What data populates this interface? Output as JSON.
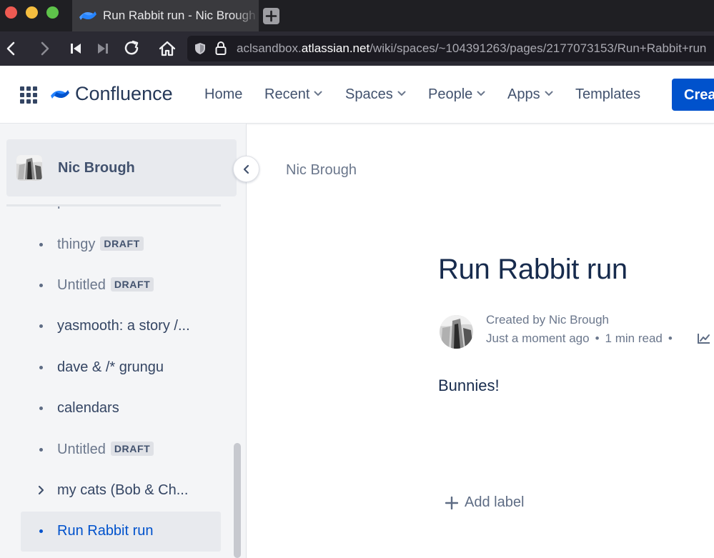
{
  "browser": {
    "tab_title": "Run Rabbit run - Nic Brough",
    "url_prefix": "aclsandbox.",
    "url_host": "atlassian.net",
    "url_path": "/wiki/spaces/~104391263/pages/2177073153/Run+Rabbit+run"
  },
  "header": {
    "logo_text": "Confluence",
    "nav": {
      "home": "Home",
      "recent": "Recent",
      "spaces": "Spaces",
      "people": "People",
      "apps": "Apps",
      "templates": "Templates"
    },
    "create_label": "Create",
    "brand_color": "#0052cc"
  },
  "sidebar": {
    "space_name": "Nic Brough",
    "draft_label": "DRAFT",
    "items": [
      {
        "label": "thingy",
        "draft": true
      },
      {
        "label": "Untitled",
        "draft": true
      },
      {
        "label": "yasmooth: a story /...",
        "draft": false
      },
      {
        "label": "dave & /* grungu",
        "draft": false
      },
      {
        "label": "calendars",
        "draft": false
      },
      {
        "label": "Untitled",
        "draft": true
      },
      {
        "label": "my cats (Bob & Ch...",
        "draft": false,
        "expandable": true
      },
      {
        "label": "Run Rabbit run",
        "draft": false,
        "current": true
      }
    ]
  },
  "page": {
    "breadcrumb": "Nic Brough",
    "title": "Run Rabbit run",
    "byline": "Created by Nic Brough",
    "timestamp": "Just a moment ago",
    "read_time": "1 min read",
    "body": "Bunnies!",
    "add_label": "Add label"
  }
}
